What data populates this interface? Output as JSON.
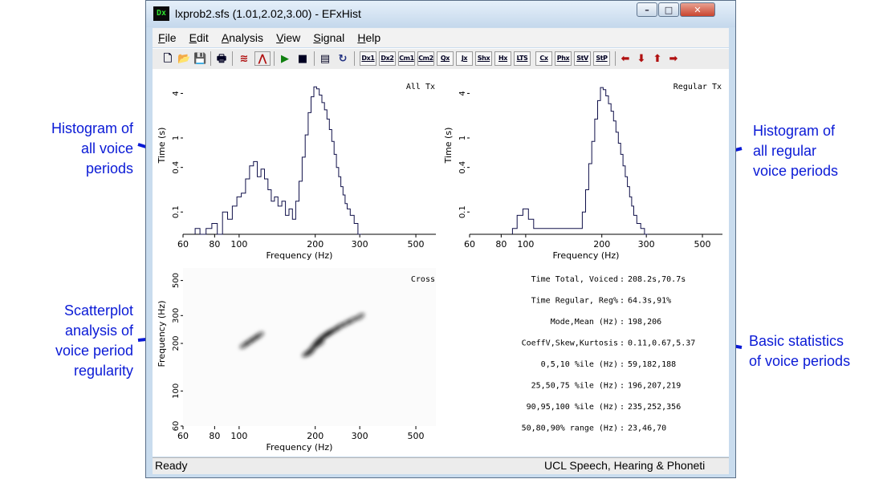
{
  "window": {
    "title": "lxprob2.sfs (1.01,2.02,3.00) - EFxHist",
    "app_icon_text": "Dx",
    "controls": {
      "minimize": "–",
      "maximize": "□",
      "close": "✕"
    }
  },
  "menu": [
    "File",
    "Edit",
    "Analysis",
    "View",
    "Signal",
    "Help"
  ],
  "toolbar": {
    "icon_buttons": [
      "new-file-icon",
      "open-folder-icon",
      "save-icon",
      "print-icon",
      "waveform-icon",
      "peak-icon",
      "play-icon",
      "stop-icon",
      "properties-icon",
      "refresh-icon"
    ],
    "text_buttons": [
      "Dx1",
      "Dx2",
      "Cm1",
      "Cm2",
      "Qx",
      "Jx",
      "Shx",
      "Hx",
      "LTS",
      "Cx",
      "Phx",
      "StV",
      "StP"
    ],
    "arrow_buttons": [
      "arrow-left-icon",
      "arrow-down-icon",
      "arrow-up-icon",
      "arrow-right-icon"
    ],
    "arrow_color": "#b01010"
  },
  "plots": {
    "all_tx": {
      "label": "All Tx",
      "xlabel": "Frequency (Hz)",
      "ylabel": "Time (s)",
      "xticks": [
        "60",
        "80",
        "100",
        "200",
        "300",
        "500"
      ],
      "yticks": [
        "4",
        "1",
        "0.4",
        "0.1"
      ]
    },
    "regular_tx": {
      "label": "Regular Tx",
      "xlabel": "Frequency (Hz)",
      "ylabel": "Time (s)",
      "xticks": [
        "60",
        "80",
        "100",
        "200",
        "300",
        "500"
      ],
      "yticks": [
        "4",
        "1",
        "0.4",
        "0.1"
      ]
    },
    "cross": {
      "label": "Cross",
      "xlabel": "Frequency (Hz)",
      "ylabel": "Frequency (Hz)",
      "xticks": [
        "60",
        "80",
        "100",
        "200",
        "300",
        "500"
      ],
      "yticks": [
        "500",
        "300",
        "200",
        "100",
        "60"
      ]
    }
  },
  "chart_data": [
    {
      "type": "bar",
      "title": "All Tx",
      "xlabel": "Frequency (Hz)",
      "ylabel": "Time (s)",
      "xscale": "log",
      "yscale": "log",
      "xlim": [
        60,
        600
      ],
      "ylim": [
        0.05,
        7
      ],
      "categories": [
        68,
        72,
        76,
        80,
        84,
        88,
        92,
        96,
        100,
        104,
        108,
        112,
        116,
        120,
        124,
        128,
        132,
        136,
        140,
        145,
        150,
        155,
        160,
        165,
        170,
        175,
        180,
        185,
        190,
        195,
        200,
        205,
        210,
        215,
        220,
        225,
        230,
        235,
        240,
        245,
        250,
        255,
        260,
        265,
        270,
        280,
        290,
        300
      ],
      "values": [
        0.06,
        0.05,
        0.06,
        0.07,
        0.05,
        0.1,
        0.08,
        0.12,
        0.16,
        0.18,
        0.28,
        0.42,
        0.48,
        0.3,
        0.38,
        0.28,
        0.2,
        0.14,
        0.16,
        0.12,
        0.14,
        0.09,
        0.11,
        0.08,
        0.14,
        0.26,
        0.55,
        1.1,
        2.2,
        3.6,
        4.9,
        4.6,
        3.8,
        3.0,
        2.4,
        1.8,
        1.3,
        0.9,
        0.6,
        0.4,
        0.3,
        0.22,
        0.17,
        0.13,
        0.11,
        0.09,
        0.07,
        0.05
      ]
    },
    {
      "type": "bar",
      "title": "Regular Tx",
      "xlabel": "Frequency (Hz)",
      "ylabel": "Time (s)",
      "xscale": "log",
      "yscale": "log",
      "xlim": [
        60,
        600
      ],
      "ylim": [
        0.05,
        7
      ],
      "categories": [
        90,
        95,
        100,
        105,
        110,
        165,
        170,
        175,
        180,
        185,
        190,
        195,
        200,
        205,
        210,
        215,
        220,
        225,
        230,
        235,
        240,
        245,
        250,
        255,
        260,
        265,
        270,
        280,
        290,
        300
      ],
      "values": [
        0.06,
        0.09,
        0.11,
        0.08,
        0.06,
        0.06,
        0.1,
        0.2,
        0.45,
        0.9,
        1.8,
        3.2,
        4.8,
        4.5,
        3.7,
        2.9,
        2.3,
        1.7,
        1.2,
        0.85,
        0.6,
        0.42,
        0.3,
        0.22,
        0.16,
        0.12,
        0.09,
        0.07,
        0.06,
        0.05
      ]
    },
    {
      "type": "scatter",
      "title": "Cross",
      "xlabel": "Frequency (Hz)",
      "ylabel": "Frequency (Hz)",
      "xscale": "log",
      "yscale": "log",
      "xlim": [
        60,
        600
      ],
      "ylim": [
        60,
        600
      ],
      "points": [
        [
          105,
          195
        ],
        [
          110,
          205
        ],
        [
          115,
          215
        ],
        [
          120,
          225
        ],
        [
          190,
          175
        ],
        [
          195,
          185
        ],
        [
          200,
          195
        ],
        [
          205,
          205
        ],
        [
          210,
          212
        ],
        [
          215,
          220
        ],
        [
          222,
          228
        ],
        [
          230,
          236
        ],
        [
          240,
          245
        ],
        [
          250,
          256
        ],
        [
          265,
          268
        ],
        [
          280,
          280
        ],
        [
          300,
          295
        ],
        [
          185,
          172
        ],
        [
          208,
          200
        ],
        [
          225,
          230
        ]
      ]
    }
  ],
  "stats": [
    {
      "label": "Time Total, Voiced",
      "value": "208.2s,70.7s"
    },
    {
      "label": "Time Regular, Reg%",
      "value": "64.3s,91%"
    },
    {
      "label": "Mode,Mean (Hz)",
      "value": "198,206"
    },
    {
      "label": "CoeffV,Skew,Kurtosis",
      "value": "0.11,0.67,5.37"
    },
    {
      "label": "0,5,10 %ile (Hz)",
      "value": "59,182,188"
    },
    {
      "label": "25,50,75 %ile (Hz)",
      "value": "196,207,219"
    },
    {
      "label": "90,95,100 %ile (Hz)",
      "value": "235,252,356"
    },
    {
      "label": "50,80,90% range (Hz)",
      "value": "23,46,70"
    }
  ],
  "status": {
    "left": "Ready",
    "right": "UCL Speech, Hearing & Phoneti"
  },
  "annotations": {
    "hist_all": [
      "Histogram of",
      "all voice",
      "periods"
    ],
    "hist_regular": [
      "Histogram of",
      "all regular",
      "voice periods"
    ],
    "scatter": [
      "Scatterplot",
      "analysis of",
      "voice period",
      "regularity"
    ],
    "stats": [
      "Basic statistics",
      "of voice periods"
    ],
    "color": "#0a1ad6"
  }
}
